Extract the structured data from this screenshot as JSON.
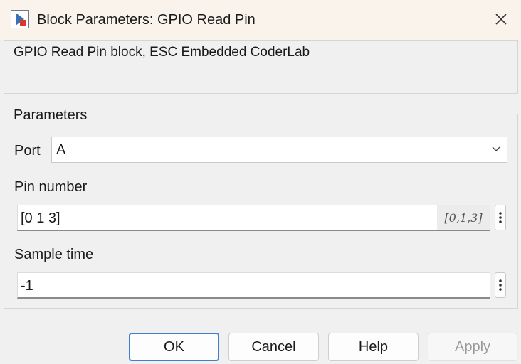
{
  "window": {
    "title": "Block Parameters: GPIO Read Pin",
    "icon": "simulink-block-icon",
    "close_icon": "close-icon"
  },
  "description": {
    "text": "GPIO Read Pin block, ESC Embedded CoderLab"
  },
  "parameters": {
    "group_label": "Parameters",
    "port": {
      "label": "Port",
      "value": "A",
      "icon": "chevron-down-icon"
    },
    "pin_number": {
      "label": "Pin number",
      "value": "[0 1 3]",
      "hint": "[0,1,3]",
      "more_icon": "vertical-ellipsis-icon"
    },
    "sample_time": {
      "label": "Sample time",
      "value": "-1",
      "more_icon": "vertical-ellipsis-icon"
    }
  },
  "buttons": {
    "ok": "OK",
    "cancel": "Cancel",
    "help": "Help",
    "apply": "Apply"
  },
  "colors": {
    "title_bg": "#f9f3ec",
    "dialog_bg": "#f0f0f0",
    "primary_border": "#3f7fd0",
    "disabled_text": "#9a9a9a"
  }
}
